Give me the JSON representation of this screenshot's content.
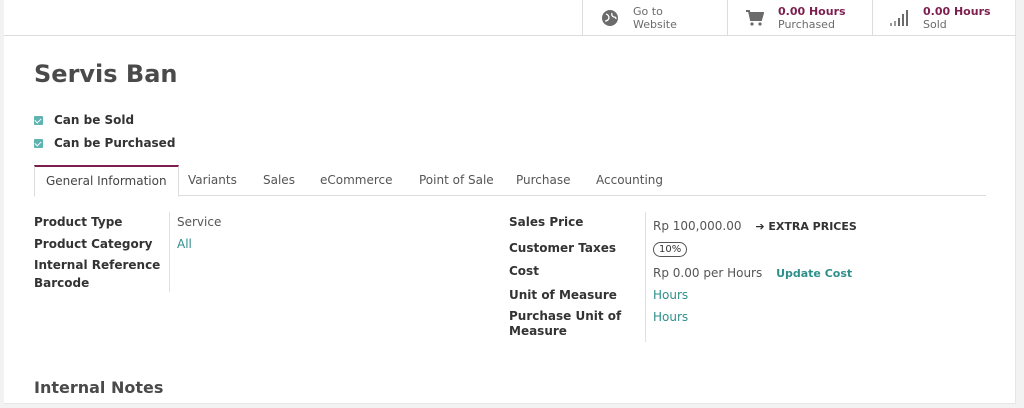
{
  "smart_buttons": {
    "website": {
      "line1": "Go to",
      "line2": "Website",
      "icon": "globe-icon"
    },
    "purchased": {
      "value": "0.00 Hours",
      "label": "Purchased",
      "icon": "cart-icon"
    },
    "sold": {
      "value": "0.00 Hours",
      "label": "Sold",
      "icon": "signal-bars-icon"
    }
  },
  "product": {
    "name": "Servis Ban",
    "can_be_sold_label": "Can be Sold",
    "can_be_purchased_label": "Can be Purchased"
  },
  "tabs": [
    {
      "label": "General Information"
    },
    {
      "label": "Variants"
    },
    {
      "label": "Sales"
    },
    {
      "label": "eCommerce"
    },
    {
      "label": "Point of Sale"
    },
    {
      "label": "Purchase"
    },
    {
      "label": "Accounting"
    }
  ],
  "left_group": {
    "product_type_label": "Product Type",
    "product_type_value": "Service",
    "product_category_label": "Product Category",
    "product_category_value": "All",
    "internal_reference_label": "Internal Reference",
    "barcode_label": "Barcode"
  },
  "right_group": {
    "sales_price_label": "Sales Price",
    "sales_price_value": "Rp 100,000.00",
    "extra_prices_label": "EXTRA PRICES",
    "customer_taxes_label": "Customer Taxes",
    "customer_taxes_value": "10%",
    "cost_label": "Cost",
    "cost_value": "Rp 0.00",
    "cost_unit": "per Hours",
    "update_cost_label": "Update Cost",
    "uom_label": "Unit of Measure",
    "uom_value": "Hours",
    "purchase_uom_label_1": "Purchase Unit of",
    "purchase_uom_label_2": "Measure",
    "purchase_uom_value": "Hours"
  },
  "notes": {
    "title": "Internal Notes"
  },
  "colors": {
    "accent": "#7c1f4f",
    "link": "#2f8f8b",
    "checkbox": "#5fb3b0"
  }
}
